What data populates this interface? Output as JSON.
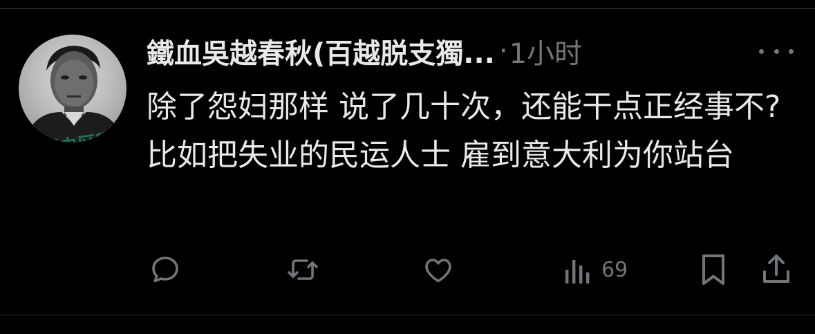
{
  "post": {
    "author_name": "鐵血吳越春秋(百越脱支獨...",
    "separator": "·",
    "timestamp": "1小时",
    "avatar_caption": "消滅白区黨",
    "text": "除了怨妇那样 说了几十次，还能干点正经事不? 比如把失业的民运人士 雇到意大利为你站台"
  },
  "actions": {
    "views_count": "69"
  },
  "icons": {
    "more": "more-options-icon",
    "reply": "reply-icon",
    "repost": "repost-icon",
    "like": "like-icon",
    "views": "views-icon",
    "bookmark": "bookmark-icon",
    "share": "share-icon"
  },
  "colors": {
    "background": "#000000",
    "primary_text": "#e7e9ea",
    "secondary_text": "#71767b",
    "divider": "#2f3336"
  }
}
